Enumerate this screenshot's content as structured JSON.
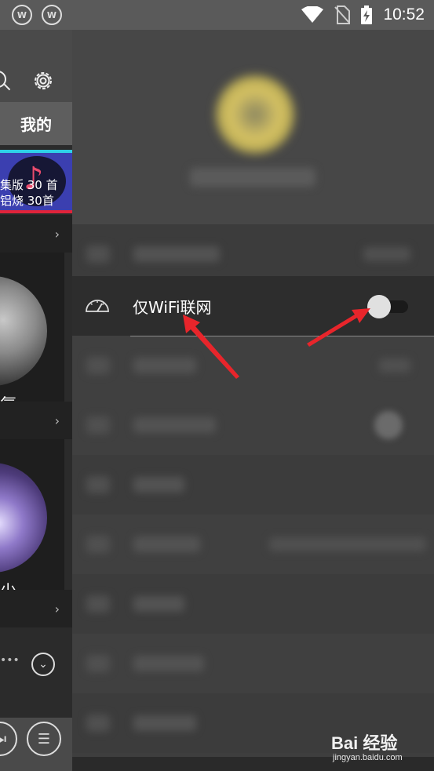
{
  "status_bar": {
    "app_icons": [
      "W",
      "W"
    ],
    "time": "10:52"
  },
  "left_panel": {
    "tab_label": "我的",
    "banner_line1": "集版 30 首",
    "banner_line2": "铝烧 30首",
    "chevron": "›",
    "card1_text": "氛",
    "card2_text": "少",
    "more_dots": "•••"
  },
  "settings": {
    "wifi_only_label": "仅WiFi联网",
    "wifi_only_enabled": false
  },
  "watermark": {
    "brand": "Bai 经验",
    "url": "jingyan.baidu.com"
  },
  "colors": {
    "accent_cyan": "#2ed0e6",
    "accent_red": "#e0233a",
    "arrow_red": "#e8252b"
  }
}
